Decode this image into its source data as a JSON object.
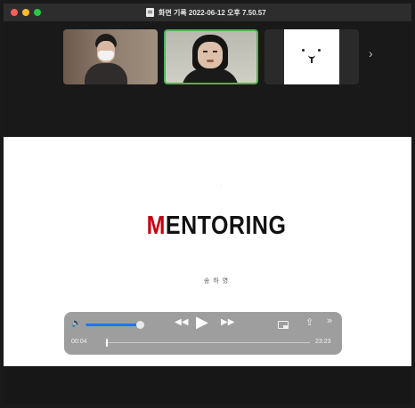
{
  "window": {
    "title": "화면 기록 2022-06-12 오후 7.50.57"
  },
  "gallery": {
    "participants": [
      {
        "name": "participant-1"
      },
      {
        "name": "participant-2-active"
      },
      {
        "name": "participant-3-bear"
      }
    ],
    "next_icon": "›"
  },
  "slide": {
    "mark": "·",
    "title_first": "M",
    "title_rest": "ENTORING",
    "author": "송 하 영"
  },
  "player": {
    "volume_icon": "🔈",
    "volume_level": 0.95,
    "rewind_icon": "◀◀",
    "play_icon": "▶",
    "forward_icon": "▶▶",
    "share_icon": "⇪",
    "more_icon": "»",
    "current_time": "00:04",
    "total_time": "23:23",
    "progress": 0.003
  },
  "colors": {
    "accent": "#1e74ff",
    "title_red": "#c40012",
    "active_speaker_border": "#4fb34f"
  }
}
